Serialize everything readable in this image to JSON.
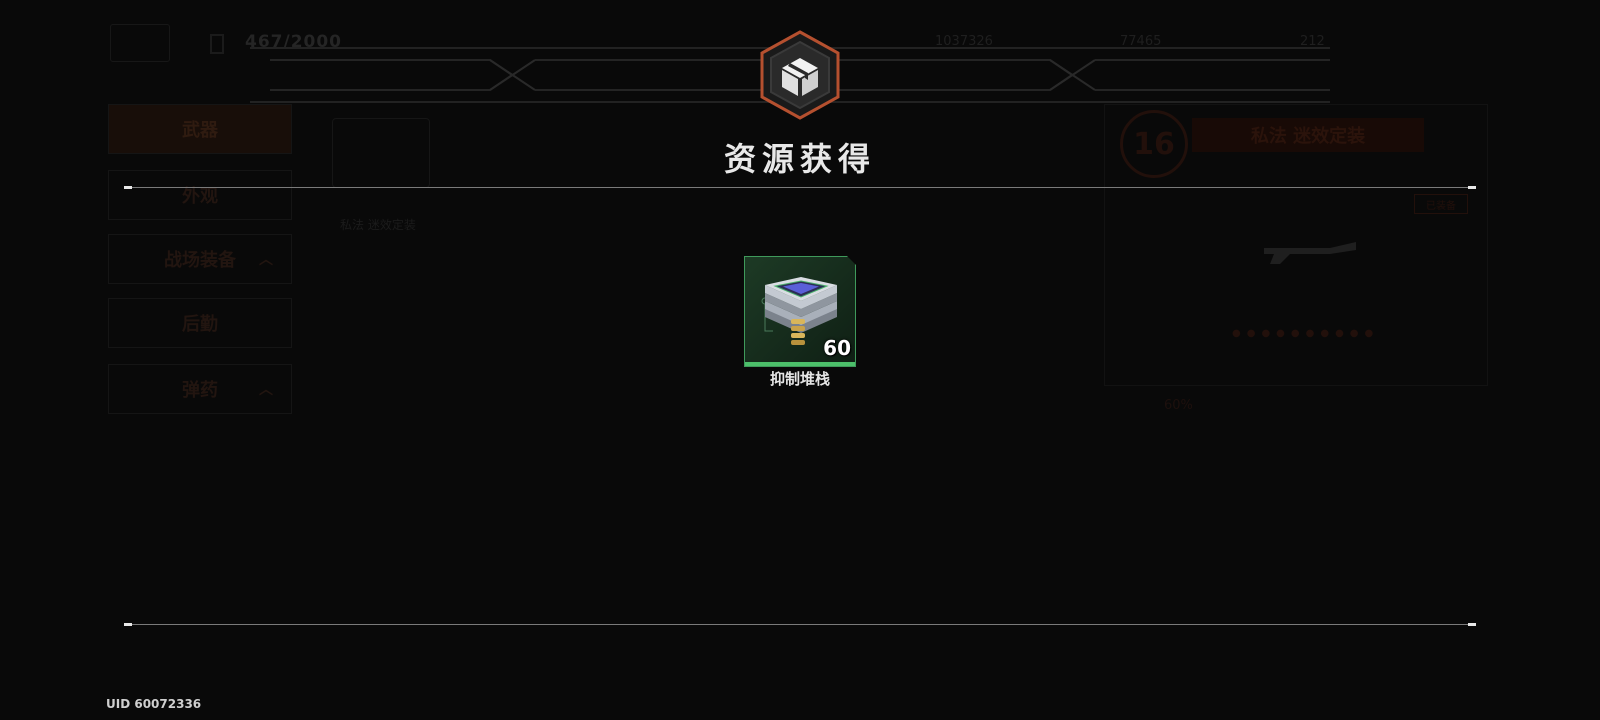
{
  "background": {
    "top_counter": "467/2000",
    "stats": [
      "1037326",
      "77465",
      "212"
    ],
    "sidebar": [
      {
        "label": "武器",
        "active": true
      },
      {
        "label": "外观"
      },
      {
        "label": "战场装备"
      },
      {
        "label": "后勤"
      },
      {
        "label": "弹药"
      }
    ],
    "card_name": "私法 迷效定装",
    "right_panel": {
      "level": "16",
      "title": "私法 迷效定装",
      "tag": "已装备",
      "percent": "60%"
    }
  },
  "modal": {
    "title": "资源获得",
    "items": [
      {
        "name": "抑制堆栈",
        "quantity": "60",
        "rarity_color": "#4cc06a",
        "icon": "chip-stack-icon"
      }
    ]
  },
  "footer": {
    "uid": "UID 60072336"
  },
  "colors": {
    "accent": "#c0502e",
    "rarity_green": "#4cc06a"
  }
}
